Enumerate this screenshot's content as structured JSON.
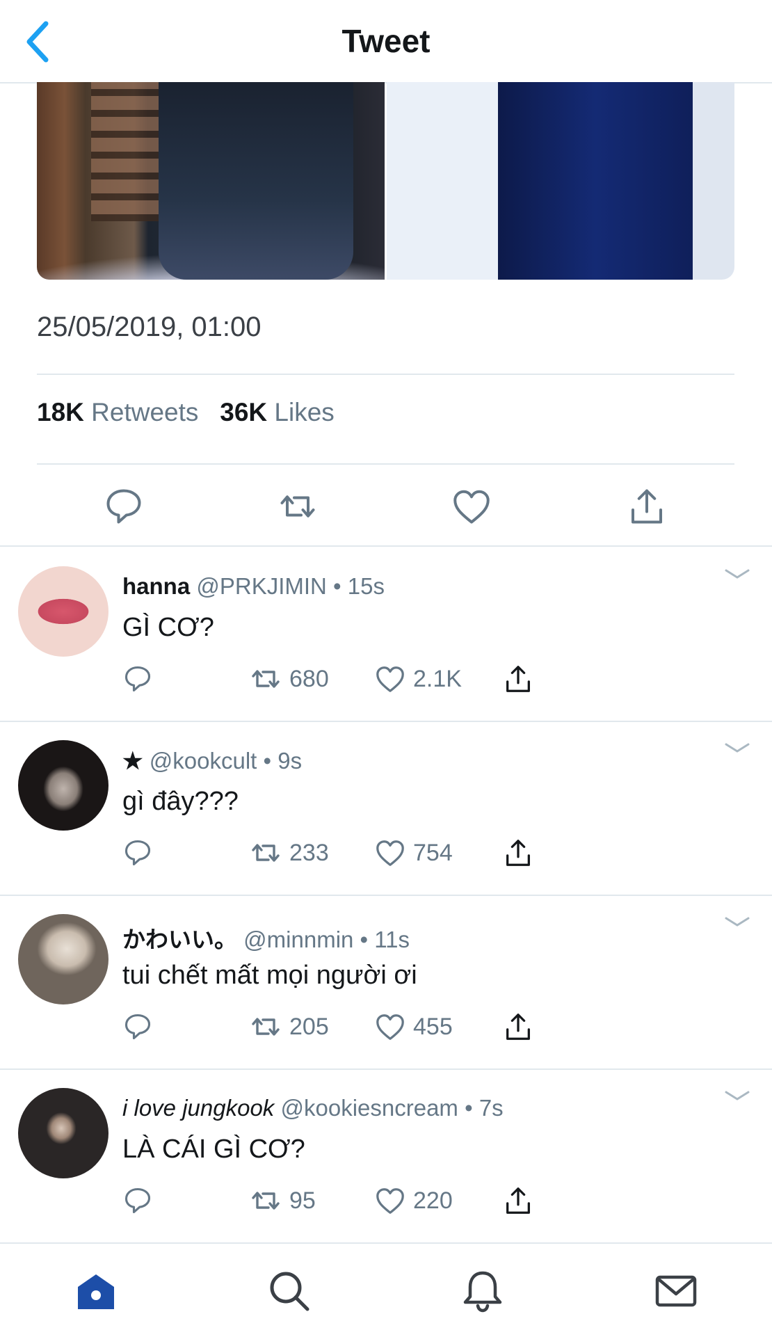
{
  "header": {
    "title": "Tweet"
  },
  "tweet": {
    "timestamp": "25/05/2019, 01:00",
    "retweets_count": "18K",
    "retweets_label": "Retweets",
    "likes_count": "36K",
    "likes_label": "Likes"
  },
  "replies": [
    {
      "name": "hanna",
      "handle": "@PRKJIMIN",
      "time": "• 15s",
      "text": "GÌ CƠ?",
      "retweets": "680",
      "likes": "2.1K"
    },
    {
      "name": "★",
      "handle": "@kookcult",
      "time": "• 9s",
      "text": "gì đây???",
      "retweets": "233",
      "likes": "754"
    },
    {
      "name": "かわいい。",
      "handle": "@minnmin",
      "time": "• 11s",
      "text": "tui chết mất mọi người ơi",
      "retweets": "205",
      "likes": "455"
    },
    {
      "name": "i love jungkook",
      "handle": "@kookiesncream",
      "time": "• 7s",
      "text": "LÀ CÁI GÌ CƠ?",
      "retweets": "95",
      "likes": "220"
    }
  ],
  "colors": {
    "accent": "#1da1f2",
    "muted": "#657786",
    "home_active": "#1d4ea8",
    "divider": "#e1e8ed"
  },
  "icons": {
    "back": "chevron-left-icon",
    "reply": "reply-icon",
    "retweet": "retweet-icon",
    "like": "heart-icon",
    "share": "share-icon",
    "more": "chevron-down-icon",
    "tabs": [
      "home-icon",
      "search-icon",
      "bell-icon",
      "mail-icon"
    ]
  }
}
